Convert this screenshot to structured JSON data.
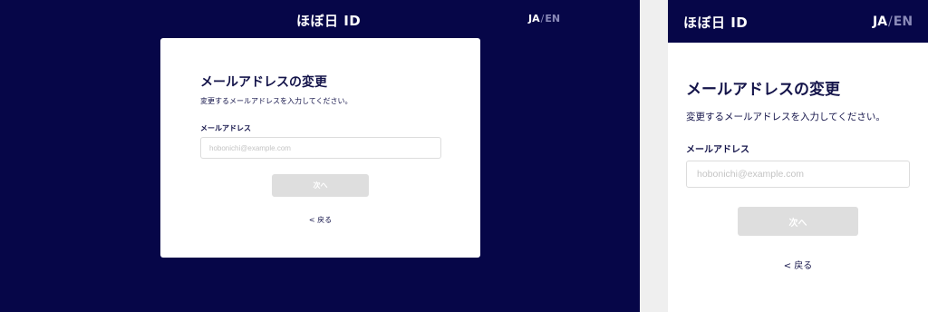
{
  "brand": {
    "logo_text": "ほぼ日 ID"
  },
  "lang": {
    "ja": "JA",
    "separator": "/",
    "en": "EN"
  },
  "form": {
    "title": "メールアドレスの変更",
    "description": "変更するメールアドレスを入力してください。",
    "email_label": "メールアドレス",
    "email_value": "",
    "email_placeholder": "hobonichi@example.com",
    "next_label": "次へ",
    "back_label": "< 戻る"
  },
  "colors": {
    "navy": "#060648",
    "text": "#14144a",
    "disabled_button": "#dedede",
    "inactive_lang": "#8a8ab8"
  }
}
